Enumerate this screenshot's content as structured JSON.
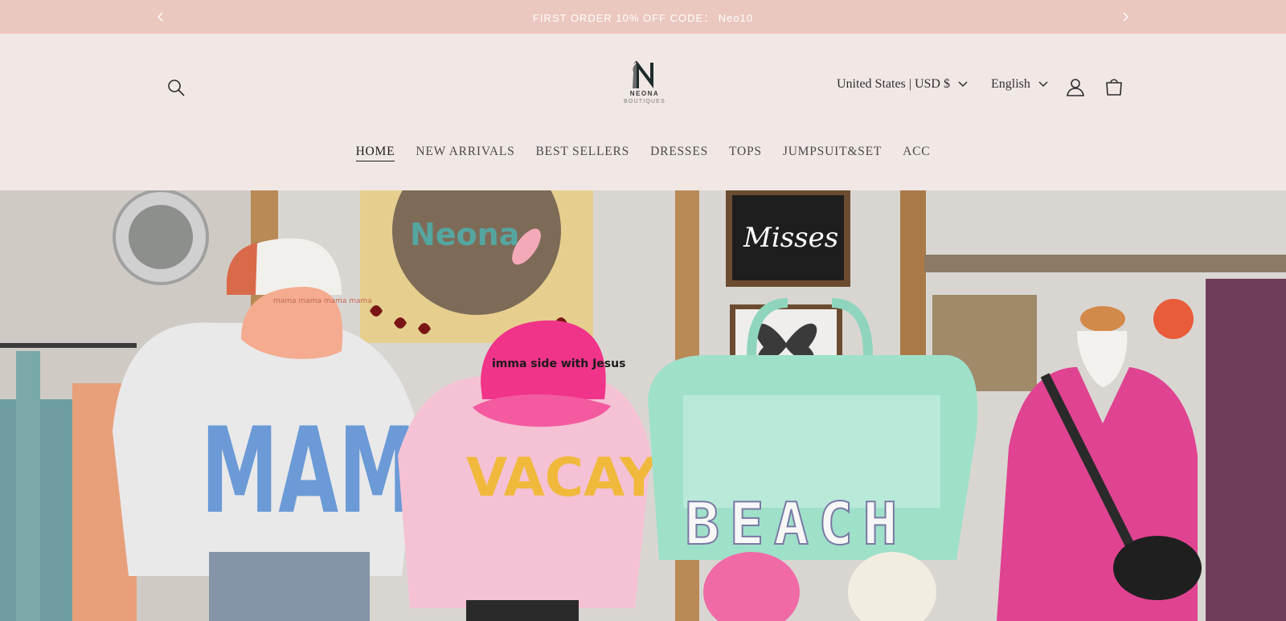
{
  "announcement": {
    "text": "FIRST ORDER 10% OFF CODE： Neo10"
  },
  "header": {
    "logo": {
      "name": "NEONA",
      "sub": "BOUTIQUES"
    },
    "country_selector": "United States | USD $",
    "language_selector": "English"
  },
  "nav": {
    "items": [
      {
        "label": "HOME",
        "active": true
      },
      {
        "label": "NEW ARRIVALS",
        "active": false
      },
      {
        "label": "BEST SELLERS",
        "active": false
      },
      {
        "label": "DRESSES",
        "active": false
      },
      {
        "label": "TOPS",
        "active": false
      },
      {
        "label": "JUMPSUIT&SET",
        "active": false
      },
      {
        "label": "ACC",
        "active": false
      }
    ]
  },
  "hero": {
    "image_text": {
      "sign_store": "Neona",
      "sign_chalkboard": "Misses",
      "cap_left": "mama mama mama mama",
      "shirt_left": "MAMA",
      "cap_middle": "imma side with Jesus",
      "shirt_middle": "VACAY",
      "bag": "BEACH"
    }
  },
  "icons": {
    "prev": "chevron-left-icon",
    "next": "chevron-right-icon",
    "search": "search-icon",
    "account": "account-icon",
    "cart": "cart-icon",
    "dropdown": "chevron-down-icon"
  },
  "colors": {
    "announcement_bg": "#eac7bf",
    "header_bg": "#f1e8e6",
    "text": "#2b2b2b"
  }
}
